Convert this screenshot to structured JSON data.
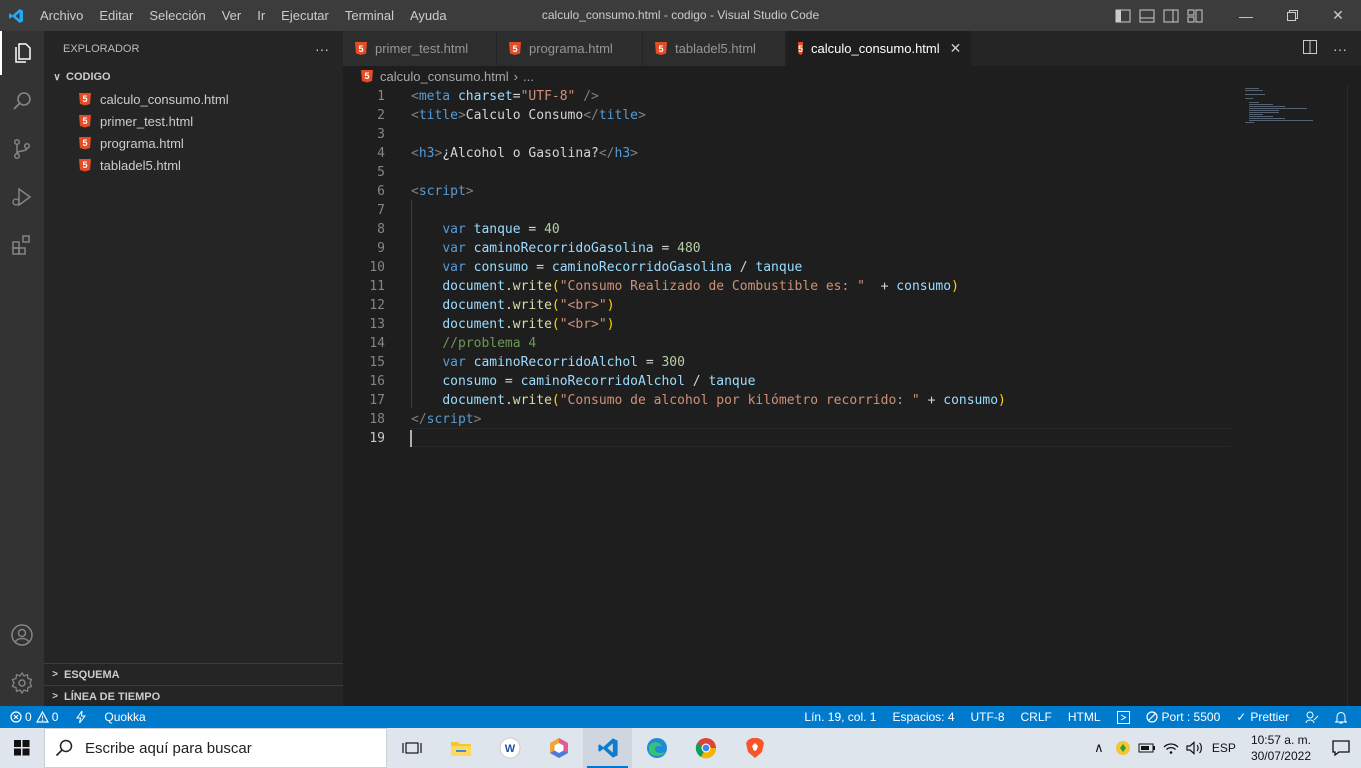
{
  "window": {
    "title": "calculo_consumo.html - codigo - Visual Studio Code",
    "menu": [
      "Archivo",
      "Editar",
      "Selección",
      "Ver",
      "Ir",
      "Ejecutar",
      "Terminal",
      "Ayuda"
    ]
  },
  "sidebar": {
    "header": "EXPLORADOR",
    "more": "···",
    "folder": "CODIGO",
    "files": [
      "calculo_consumo.html",
      "primer_test.html",
      "programa.html",
      "tabladel5.html"
    ],
    "outline": "ESQUEMA",
    "timeline": "LÍNEA DE TIEMPO"
  },
  "tabs": [
    {
      "label": "primer_test.html"
    },
    {
      "label": "programa.html"
    },
    {
      "label": "tabladel5.html"
    },
    {
      "label": "calculo_consumo.html"
    }
  ],
  "tab_close": "✕",
  "breadcrumb": {
    "file": "calculo_consumo.html",
    "sep": "›",
    "more": "..."
  },
  "editor": {
    "line_numbers": [
      "1",
      "2",
      "3",
      "4",
      "5",
      "6",
      "7",
      "8",
      "9",
      "10",
      "11",
      "12",
      "13",
      "14",
      "15",
      "16",
      "17",
      "18",
      "19"
    ],
    "lines": [
      [
        [
          "t-br",
          "<"
        ],
        [
          "t-tag",
          "meta"
        ],
        [
          "t-txt",
          " "
        ],
        [
          "t-attr",
          "charset"
        ],
        [
          "t-txt",
          "="
        ],
        [
          "t-str",
          "\"UTF-8\""
        ],
        [
          "t-txt",
          " "
        ],
        [
          "t-br",
          "/>"
        ]
      ],
      [
        [
          "t-br",
          "<"
        ],
        [
          "t-tag",
          "title"
        ],
        [
          "t-br",
          ">"
        ],
        [
          "t-txt",
          "Calculo Consumo"
        ],
        [
          "t-br",
          "</"
        ],
        [
          "t-tag",
          "title"
        ],
        [
          "t-br",
          ">"
        ]
      ],
      [],
      [
        [
          "t-br",
          "<"
        ],
        [
          "t-tag",
          "h3"
        ],
        [
          "t-br",
          ">"
        ],
        [
          "t-txt",
          "¿Alcohol o Gasolina?"
        ],
        [
          "t-br",
          "</"
        ],
        [
          "t-tag",
          "h3"
        ],
        [
          "t-br",
          ">"
        ]
      ],
      [],
      [
        [
          "t-br",
          "<"
        ],
        [
          "t-tag",
          "script"
        ],
        [
          "t-br",
          ">"
        ]
      ],
      [],
      [
        [
          "t-txt",
          "    "
        ],
        [
          "t-tag",
          "var"
        ],
        [
          "t-txt",
          " "
        ],
        [
          "t-attr",
          "tanque"
        ],
        [
          "t-txt",
          " = "
        ],
        [
          "t-num",
          "40"
        ]
      ],
      [
        [
          "t-txt",
          "    "
        ],
        [
          "t-tag",
          "var"
        ],
        [
          "t-txt",
          " "
        ],
        [
          "t-attr",
          "caminoRecorridoGasolina"
        ],
        [
          "t-txt",
          " = "
        ],
        [
          "t-num",
          "480"
        ]
      ],
      [
        [
          "t-txt",
          "    "
        ],
        [
          "t-tag",
          "var"
        ],
        [
          "t-txt",
          " "
        ],
        [
          "t-attr",
          "consumo"
        ],
        [
          "t-txt",
          " = "
        ],
        [
          "t-attr",
          "caminoRecorridoGasolina"
        ],
        [
          "t-txt",
          " / "
        ],
        [
          "t-attr",
          "tanque"
        ]
      ],
      [
        [
          "t-txt",
          "    "
        ],
        [
          "t-attr",
          "document"
        ],
        [
          "t-txt",
          "."
        ],
        [
          "t-fn",
          "write"
        ],
        [
          "t-par",
          "("
        ],
        [
          "t-str",
          "\"Consumo Realizado de Combustible es: \""
        ],
        [
          "t-txt",
          "  + "
        ],
        [
          "t-attr",
          "consumo"
        ],
        [
          "t-par",
          ")"
        ]
      ],
      [
        [
          "t-txt",
          "    "
        ],
        [
          "t-attr",
          "document"
        ],
        [
          "t-txt",
          "."
        ],
        [
          "t-fn",
          "write"
        ],
        [
          "t-par",
          "("
        ],
        [
          "t-str",
          "\"<br>\""
        ],
        [
          "t-par",
          ")"
        ]
      ],
      [
        [
          "t-txt",
          "    "
        ],
        [
          "t-attr",
          "document"
        ],
        [
          "t-txt",
          "."
        ],
        [
          "t-fn",
          "write"
        ],
        [
          "t-par",
          "("
        ],
        [
          "t-str",
          "\"<br>\""
        ],
        [
          "t-par",
          ")"
        ]
      ],
      [
        [
          "t-txt",
          "    "
        ],
        [
          "t-com",
          "//problema 4"
        ]
      ],
      [
        [
          "t-txt",
          "    "
        ],
        [
          "t-tag",
          "var"
        ],
        [
          "t-txt",
          " "
        ],
        [
          "t-attr",
          "caminoRecorridoAlchol"
        ],
        [
          "t-txt",
          " = "
        ],
        [
          "t-num",
          "300"
        ]
      ],
      [
        [
          "t-txt",
          "    "
        ],
        [
          "t-attr",
          "consumo"
        ],
        [
          "t-txt",
          " = "
        ],
        [
          "t-attr",
          "caminoRecorridoAlchol"
        ],
        [
          "t-txt",
          " / "
        ],
        [
          "t-attr",
          "tanque"
        ]
      ],
      [
        [
          "t-txt",
          "    "
        ],
        [
          "t-attr",
          "document"
        ],
        [
          "t-txt",
          "."
        ],
        [
          "t-fn",
          "write"
        ],
        [
          "t-par",
          "("
        ],
        [
          "t-str",
          "\"Consumo de alcohol por kilómetro recorrido: \""
        ],
        [
          "t-txt",
          " + "
        ],
        [
          "t-attr",
          "consumo"
        ],
        [
          "t-par",
          ")"
        ]
      ],
      [
        [
          "t-br",
          "</"
        ],
        [
          "t-tag",
          "script"
        ],
        [
          "t-br",
          ">"
        ]
      ],
      []
    ]
  },
  "status": {
    "errors": "0",
    "warnings": "0",
    "quokka": "Quokka",
    "position": "Lín. 19, col. 1",
    "spaces": "Espacios: 4",
    "encoding": "UTF-8",
    "eol": "CRLF",
    "language": "HTML",
    "port": "Port : 5500",
    "prettier": "Prettier"
  },
  "taskbar": {
    "search_placeholder": "Escribe aquí para buscar",
    "language": "ESP",
    "time": "10:57 a. m.",
    "date": "30/07/2022"
  },
  "colors": {
    "accent": "#007acc",
    "html_icon": "#e44d26"
  }
}
